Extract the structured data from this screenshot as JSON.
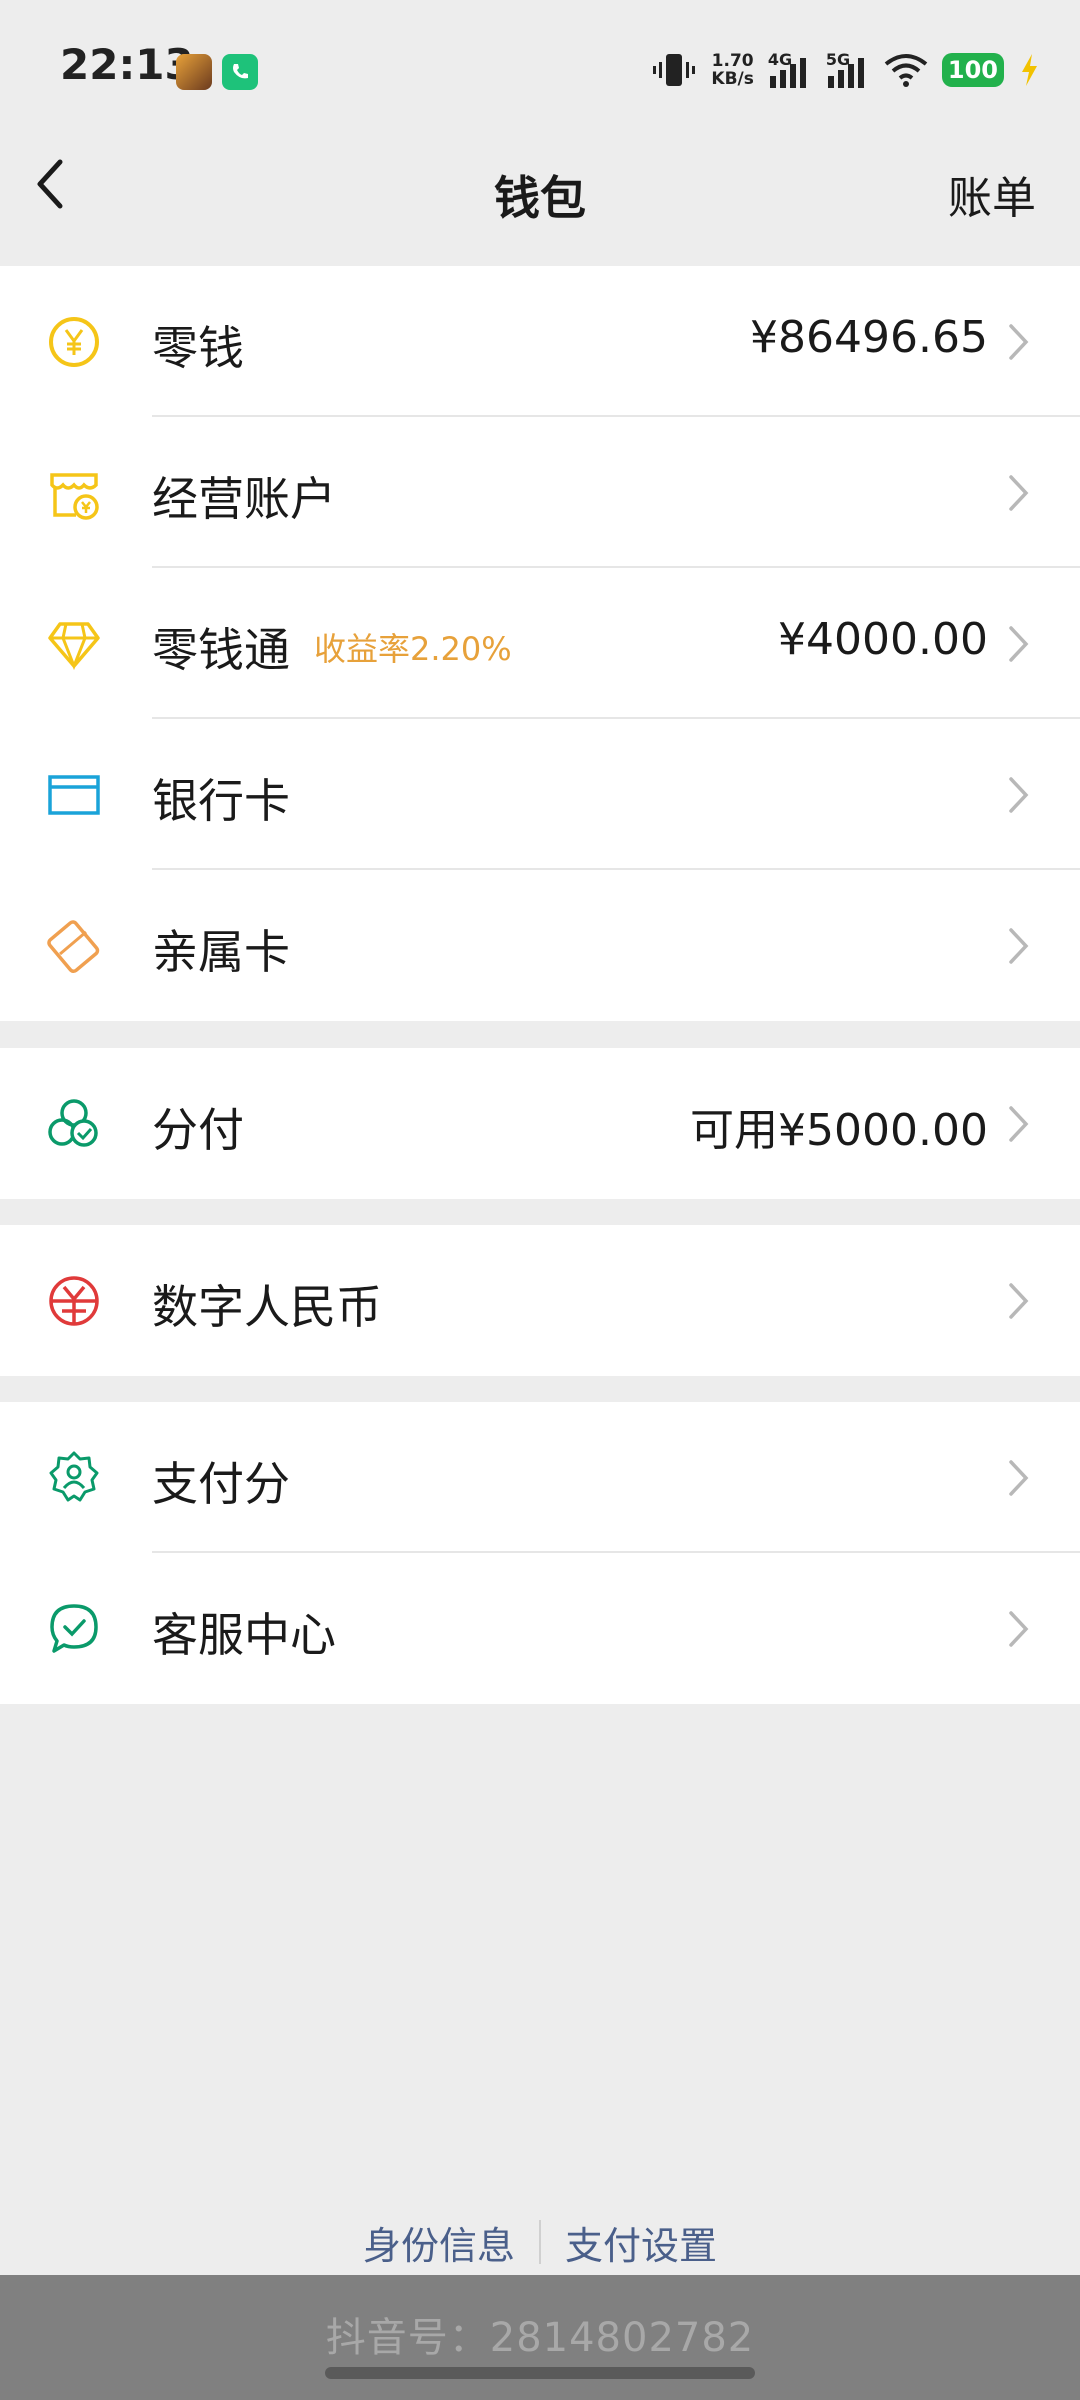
{
  "status_bar": {
    "time": "22:13",
    "net_speed_value": "1.70",
    "net_speed_unit": "KB/s",
    "signal_1_label": "4G",
    "signal_2_label": "5G",
    "battery": "100"
  },
  "header": {
    "title": "钱包",
    "right_link": "账单"
  },
  "items": {
    "change": {
      "label": "零钱",
      "value": "¥86496.65",
      "icon": "yuan-coin-icon"
    },
    "business": {
      "label": "经营账户",
      "icon": "shop-icon"
    },
    "lqt": {
      "label": "零钱通",
      "sub": "收益率2.20%",
      "value": "¥4000.00",
      "icon": "diamond-icon"
    },
    "bankcard": {
      "label": "银行卡",
      "icon": "card-icon"
    },
    "family": {
      "label": "亲属卡",
      "icon": "family-card-icon"
    },
    "fenfu": {
      "label": "分付",
      "value": "可用¥5000.00",
      "icon": "fenfu-icon"
    },
    "ecny": {
      "label": "数字人民币",
      "icon": "ecny-icon"
    },
    "score": {
      "label": "支付分",
      "icon": "score-badge-icon"
    },
    "service": {
      "label": "客服中心",
      "icon": "service-chat-icon"
    }
  },
  "footer": {
    "identity": "身份信息",
    "settings": "支付设置"
  },
  "overlay": {
    "watermark": "抖音号：2814802782"
  },
  "colors": {
    "accent_yellow": "#f5c518",
    "accent_orange": "#e7a13a",
    "accent_blue": "#1aa3d9",
    "accent_green": "#0a9a6a",
    "accent_red": "#e03a3a",
    "link_blue": "#4a5f8a"
  }
}
